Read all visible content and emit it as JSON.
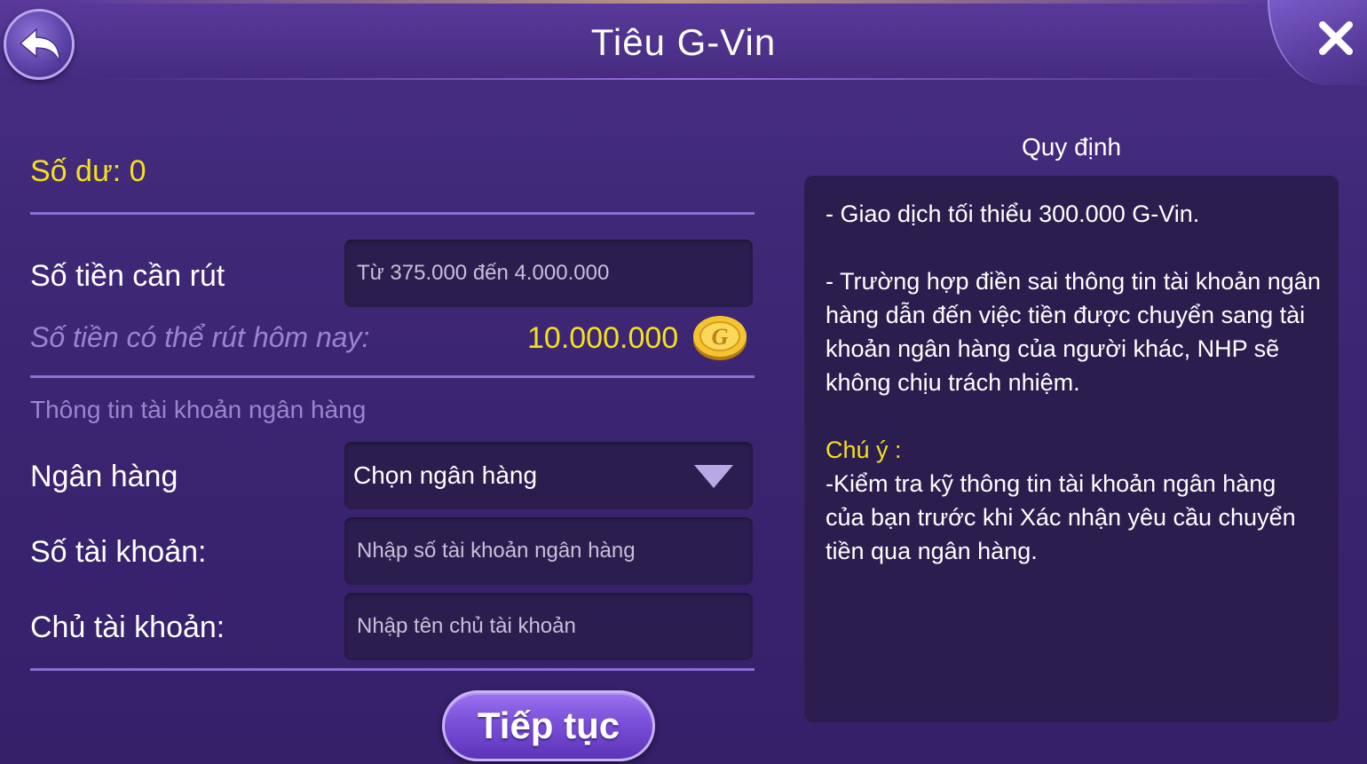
{
  "header": {
    "title": "Tiêu G-Vin"
  },
  "form": {
    "balance": "Số dư: 0",
    "amount_label": "Số tiền cần rút",
    "amount_placeholder": "Từ 375.000 đến 4.000.000",
    "available_label": "Số tiền có thể rút hôm nay:",
    "available_value": "10.000.000",
    "bank_section_title": "Thông tin tài khoản ngân hàng",
    "bank_label": "Ngân hàng",
    "bank_select_value": "Chọn ngân hàng",
    "account_number_label": "Số tài khoản:",
    "account_number_placeholder": "Nhập số tài khoản ngân hàng",
    "account_holder_label": "Chủ tài khoản:",
    "account_holder_placeholder": "Nhập tên chủ tài khoản",
    "continue_label": "Tiếp tục"
  },
  "rules": {
    "title": "Quy định",
    "rule_1": "- Giao dịch tối thiểu 300.000 G-Vin.",
    "rule_2": "- Trường hợp điền sai thông tin tài khoản ngân hàng dẫn đến việc tiền được chuyển sang tài khoản ngân hàng của người khác, NHP sẽ không chịu trách nhiệm.",
    "note_title": "Chú ý :",
    "note_text": "-Kiểm tra kỹ thông tin tài khoản ngân hàng của bạn trước khi Xác nhận yêu cầu chuyển tiền qua ngân hàng."
  },
  "icons": {
    "back": "back-arrow-icon",
    "close": "close-icon",
    "coin": "g-coin-icon",
    "dropdown": "chevron-down-icon"
  },
  "colors": {
    "accent_yellow": "#f5e01c",
    "muted_purple": "#9a86cf",
    "panel_bg": "#2b1e4f",
    "background": "#3f2877"
  }
}
